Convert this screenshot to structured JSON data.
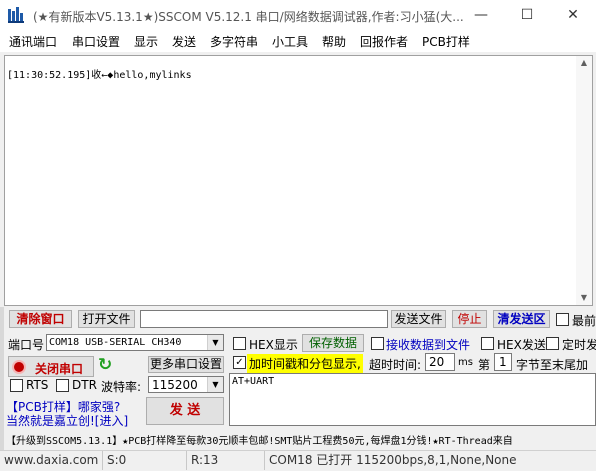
{
  "window": {
    "title": "(★有新版本V5.13.1★)SSCOM V5.12.1 串口/网络数据调试器,作者:习小猛(大...",
    "minimize_glyph": "—",
    "maximize_glyph": "☐",
    "close_glyph": "✕"
  },
  "menu": [
    "通讯端口",
    "串口设置",
    "显示",
    "发送",
    "多字符串",
    "小工具",
    "帮助",
    "回报作者",
    "PCB打样"
  ],
  "receive": {
    "lines": [
      "[11:30:52.195]收←◆hello,mylinks"
    ]
  },
  "toolbar": {
    "clear_window": "清除窗口",
    "open_file": "打开文件",
    "file_path": "",
    "send_file": "发送文件",
    "stop": "停止",
    "clear_send": "清发送区",
    "topmost": "最前"
  },
  "port": {
    "port_label": "端口号",
    "port_value": "COM18 USB-SERIAL CH340",
    "close_port": "关闭串口",
    "refresh_glyph": "↻",
    "more_settings": "更多串口设置",
    "rts": "RTS",
    "dtr": "DTR",
    "baud_label": "波特率:",
    "baud_value": "115200"
  },
  "options": {
    "hex_display": "HEX显示",
    "save_data": "保存数据",
    "recv_to_file": "接收数据到文件",
    "hex_send": "HEX发送",
    "timed_send": "定时发",
    "timestamp": "加时间戳和分包显示,",
    "timeout_label": "超时时间:",
    "timeout_value": "20",
    "timeout_unit": "ms",
    "nth_label": "第",
    "nth_value": "1",
    "bytes_to_end": "字节至末尾加"
  },
  "send": {
    "text": "AT+UART",
    "send_button": "发 送"
  },
  "promo": {
    "line1": "【PCB打样】哪家强?",
    "line2": "当然就是嘉立创![进入]",
    "ticker": "【升级到SSCOM5.13.1】★PCB打样降至每款30元顺丰包邮!SMT贴片工程费50元,每焊盘1分钱!★RT-Thread来自"
  },
  "status": {
    "website": "www.daxia.com",
    "sent": "S:0",
    "received": "R:13",
    "port_state": "COM18 已打开  115200bps,8,1,None,None"
  },
  "colors": {
    "accent_red": "#c00000",
    "accent_blue": "#0000c0",
    "highlight_yellow": "#ffff00"
  }
}
